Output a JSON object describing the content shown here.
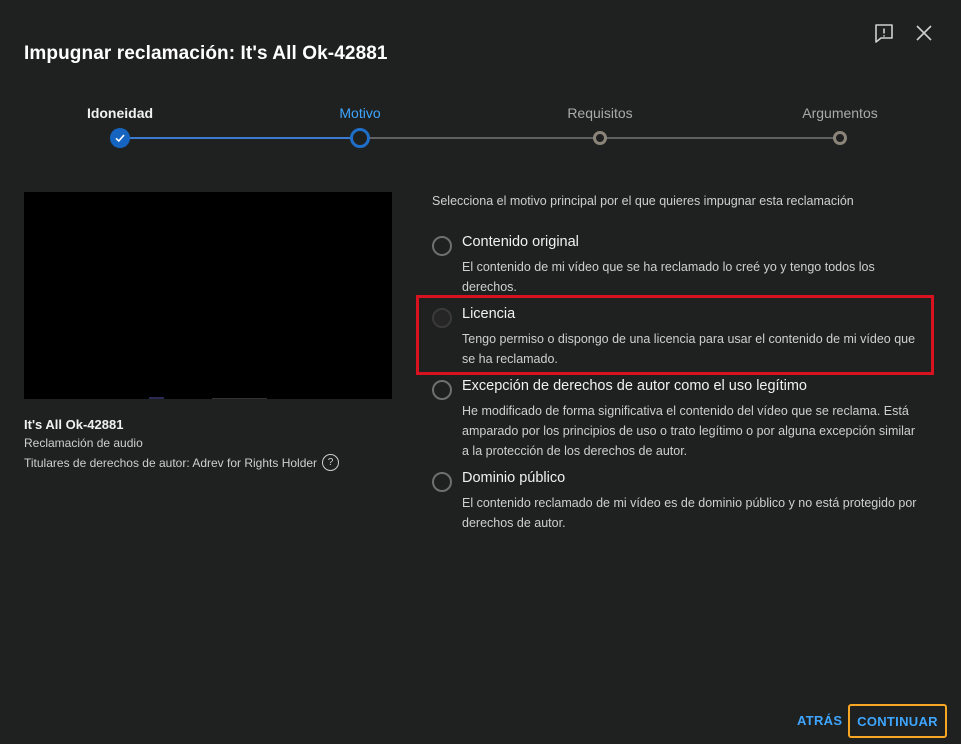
{
  "dialog": {
    "title": "Impugnar reclamación: It's All Ok-42881"
  },
  "header": {
    "feedback_icon": "feedback-icon",
    "close_icon": "close-icon"
  },
  "stepper": {
    "steps": [
      {
        "label": "Idoneidad",
        "state": "done"
      },
      {
        "label": "Motivo",
        "state": "active"
      },
      {
        "label": "Requisitos",
        "state": "future"
      },
      {
        "label": "Argumentos",
        "state": "future"
      }
    ]
  },
  "video": {
    "title": "It's All Ok-42881",
    "claim_type": "Reclamación de audio",
    "rights_holders": "Titulares de derechos de autor: Adrev for Rights Holder",
    "help_glyph": "?"
  },
  "reasons": {
    "instruction": "Selecciona el motivo principal por el que quieres impugnar esta reclamación",
    "options": [
      {
        "title": "Contenido original",
        "description": "El contenido de mi vídeo que se ha reclamado lo creé yo y tengo todos los derechos."
      },
      {
        "title": "Licencia",
        "description": "Tengo permiso o dispongo de una licencia para usar el contenido de mi vídeo que se ha reclamado."
      },
      {
        "title": "Excepción de derechos de autor como el uso legítimo",
        "description": "He modificado de forma significativa el contenido del vídeo que se reclama. Está amparado por los principios de uso o trato legítimo o por alguna excepción similar a la protección de los derechos de autor."
      },
      {
        "title": "Dominio público",
        "description": "El contenido reclamado de mi vídeo es de dominio público y no está protegido por derechos de autor."
      }
    ]
  },
  "footer": {
    "back_label": "ATRÁS",
    "continue_label": "CONTINUAR"
  },
  "colors": {
    "background": "#1f2020",
    "accent": "#3ea6ff",
    "highlight_red": "#d9121f",
    "highlight_orange": "#f5a623"
  }
}
